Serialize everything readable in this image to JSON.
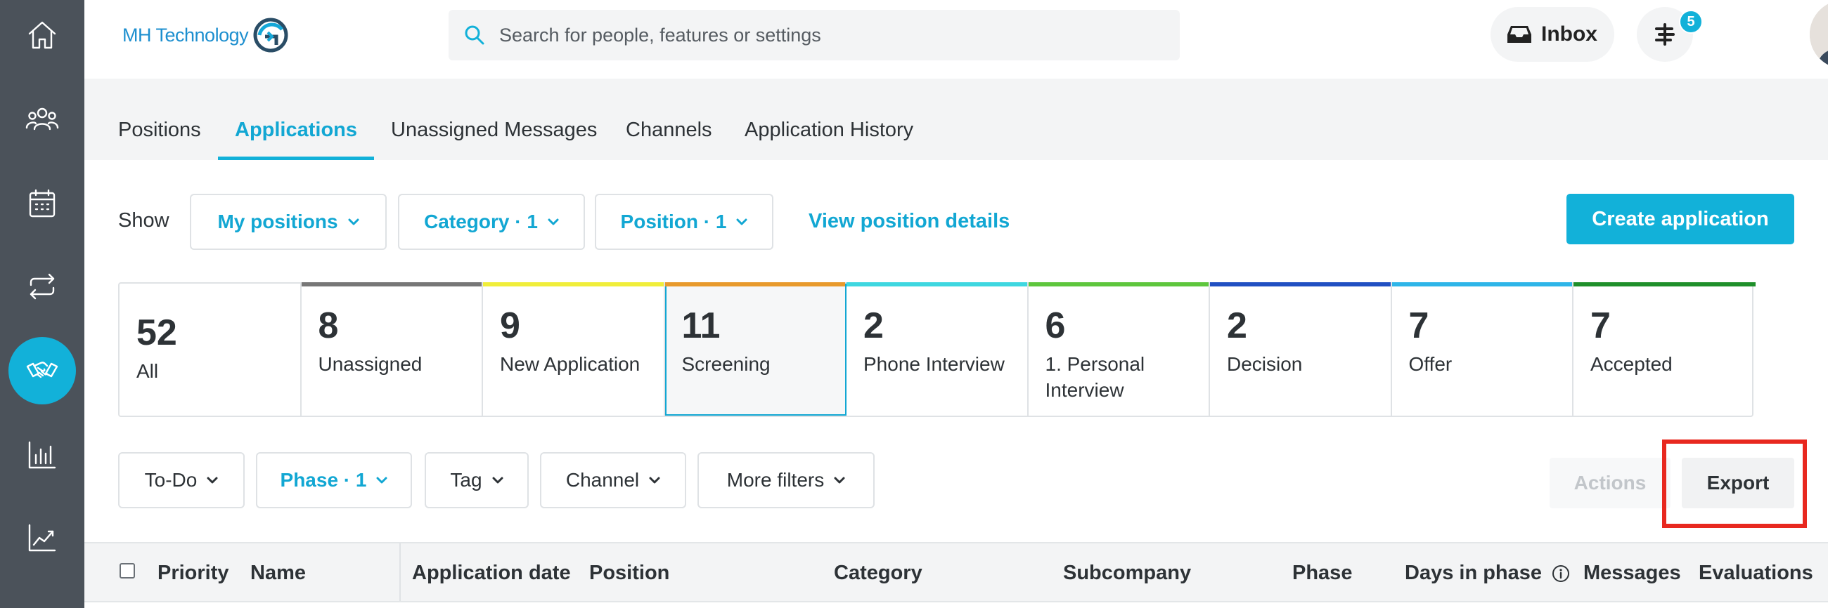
{
  "brand": {
    "name": "MH Technology"
  },
  "colors": {
    "accent": "#12b1d9",
    "sidebar": "#4b525a",
    "highlight": "#e8281f"
  },
  "sidebar": {
    "items": [
      {
        "icon": "home-icon"
      },
      {
        "icon": "people-icon"
      },
      {
        "icon": "calendar-icon"
      },
      {
        "icon": "sync-icon"
      },
      {
        "icon": "handshake-icon",
        "active": true
      },
      {
        "icon": "bar-chart-icon"
      },
      {
        "icon": "trend-chart-icon"
      }
    ]
  },
  "header": {
    "search_placeholder": "Search for people, features or settings",
    "inbox_label": "Inbox",
    "notification_count": "5"
  },
  "tabs": [
    {
      "label": "Positions"
    },
    {
      "label": "Applications",
      "active": true
    },
    {
      "label": "Unassigned Messages"
    },
    {
      "label": "Channels"
    },
    {
      "label": "Application History"
    }
  ],
  "filters": {
    "show_label": "Show",
    "my_positions": "My positions",
    "category": "Category · 1",
    "position": "Position · 1",
    "view_details": "View position details",
    "create_button": "Create application"
  },
  "phases": [
    {
      "count": "52",
      "label": "All",
      "color": ""
    },
    {
      "count": "8",
      "label": "Unassigned",
      "color": "#777777"
    },
    {
      "count": "9",
      "label": "New Application",
      "color": "#f0ee3a"
    },
    {
      "count": "11",
      "label": "Screening",
      "color": "#e89a2c",
      "selected": true
    },
    {
      "count": "2",
      "label": "Phone Interview",
      "color": "#3ed7e0"
    },
    {
      "count": "6",
      "label": "1. Personal Interview",
      "color": "#5ec63d"
    },
    {
      "count": "2",
      "label": "Decision",
      "color": "#2150c2"
    },
    {
      "count": "7",
      "label": "Offer",
      "color": "#2eb5e8"
    },
    {
      "count": "7",
      "label": "Accepted",
      "color": "#1f8f2a"
    }
  ],
  "filter_row2": {
    "todo": "To-Do",
    "phase": "Phase · 1",
    "tag": "Tag",
    "channel": "Channel",
    "more": "More filters",
    "actions": "Actions",
    "export": "Export"
  },
  "table": {
    "columns": [
      "Priority",
      "Name",
      "Application date",
      "Position",
      "Category",
      "Subcompany",
      "Phase",
      "Days in phase",
      "Messages",
      "Evaluations"
    ]
  }
}
